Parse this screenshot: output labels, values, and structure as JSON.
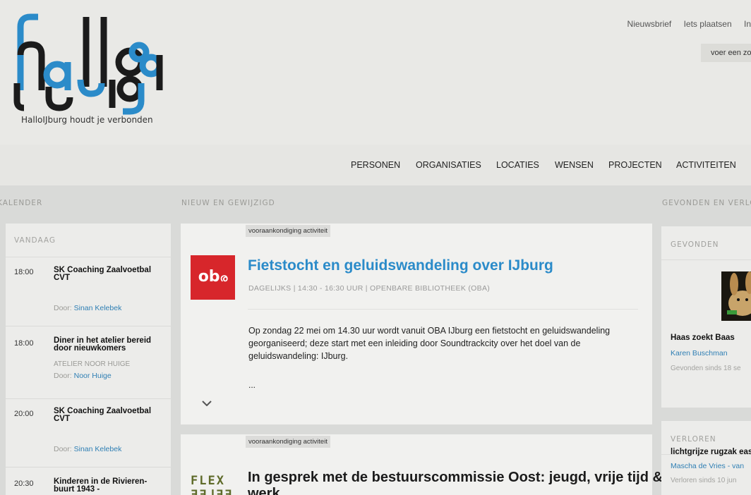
{
  "header": {
    "tagline": "HalloIJburg houdt je verbonden",
    "top_links": [
      "Nieuwsbrief",
      "Iets plaatsen",
      "In"
    ],
    "search_placeholder": "voer een zo",
    "colors": {
      "blue": "#2b8bc9",
      "dark": "#1b1b1b"
    }
  },
  "nav": {
    "items": [
      "PERSONEN",
      "ORGANISATIES",
      "LOCATIES",
      "WENSEN",
      "PROJECTEN",
      "ACTIVITEITEN"
    ]
  },
  "columns": {
    "calendar": "KALENDER",
    "news": "NIEUW EN GEWIJZIGD",
    "found_lost": "GEVONDEN EN VERLO"
  },
  "calendar": {
    "today": "VANDAAG",
    "items": [
      {
        "time": "18:00",
        "title": "SK Coaching Zaalvoetbal CVT",
        "location": "",
        "by_label": "Door:",
        "by": "Sinan Kelebek"
      },
      {
        "time": "18:00",
        "title": "Diner in het atelier bereid door nieuwkomers",
        "location": "ATELIER NOOR HUIGE",
        "by_label": "Door:",
        "by": "Noor Huige"
      },
      {
        "time": "20:00",
        "title": "SK Coaching Zaalvoetbal CVT",
        "location": "",
        "by_label": "Door:",
        "by": "Sinan Kelebek"
      },
      {
        "time": "20:30",
        "title": "Kinderen in de Rivieren-buurt 1943 -",
        "location": "",
        "by_label": "",
        "by": ""
      }
    ]
  },
  "news": [
    {
      "tag": "vooraankondiging activiteit",
      "logo": "ob",
      "title": "Fietstocht en geluidswandeling over IJburg",
      "meta": "DAGELIJKS  |  14:30 - 16:30 UUR  |  OPENBARE BIBLIOTHEEK (OBA)",
      "description": "Op zondag 22 mei om 14.30 uur wordt vanuit OBA IJburg een fietstocht en geluidswandeling georganiseerd; deze start met een inleiding door Soundtrackcity over het doel van de geluidswandeling: IJburg.",
      "ellipsis": "...",
      "colors": {
        "title": "#2b8bc9",
        "logo_bg": "#d7262b"
      }
    },
    {
      "tag": "vooraankondiging activiteit",
      "logo": "FLEX",
      "title": "In gesprek met de bestuurscommissie Oost: jeugd, vrije tijd &",
      "title_line2": "werk"
    }
  ],
  "found": {
    "heading": "GEVONDEN",
    "title": "Haas zoekt Baas",
    "name": "Karen Buschman",
    "date": "Gevonden sinds 18 se"
  },
  "lost": {
    "heading": "VERLOREN",
    "title": "lichtgrijze rugzak eas",
    "name": "Mascha de Vries - van",
    "date": "Verloren sinds 10 jun"
  }
}
